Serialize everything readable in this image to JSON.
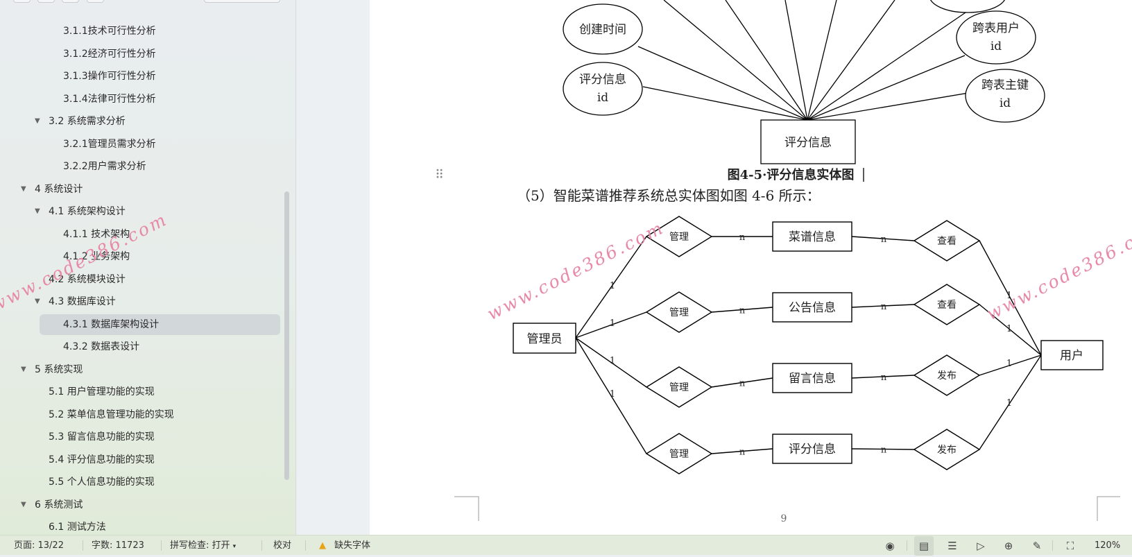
{
  "sidebar": {
    "toc": [
      {
        "label": "3.1.1技术可行性分析",
        "level": 3
      },
      {
        "label": "3.1.2经济可行性分析",
        "level": 3
      },
      {
        "label": "3.1.3操作可行性分析",
        "level": 3
      },
      {
        "label": "3.1.4法律可行性分析",
        "level": 3
      },
      {
        "label": "3.2 系统需求分析",
        "level": 2,
        "expanded": true
      },
      {
        "label": "3.2.1管理员需求分析",
        "level": 3
      },
      {
        "label": "3.2.2用户需求分析",
        "level": 3
      },
      {
        "label": "4 系统设计",
        "level": 1,
        "expanded": true
      },
      {
        "label": "4.1 系统架构设计",
        "level": 2,
        "expanded": true
      },
      {
        "label": "4.1.1 技术架构",
        "level": 3
      },
      {
        "label": "4.1.2 业务架构",
        "level": 3
      },
      {
        "label": "4.2 系统模块设计",
        "level": 2
      },
      {
        "label": "4.3 数据库设计",
        "level": 2,
        "expanded": true
      },
      {
        "label": "4.3.1 数据库架构设计",
        "level": 3,
        "selected": true
      },
      {
        "label": "4.3.2 数据表设计",
        "level": 3
      },
      {
        "label": "5 系统实现",
        "level": 1,
        "expanded": true
      },
      {
        "label": "5.1 用户管理功能的实现",
        "level": 2
      },
      {
        "label": "5.2 菜单信息管理功能的实现",
        "level": 2
      },
      {
        "label": "5.3 留言信息功能的实现",
        "level": 2
      },
      {
        "label": "5.4 评分信息功能的实现",
        "level": 2
      },
      {
        "label": "5.5 个人信息功能的实现",
        "level": 2
      },
      {
        "label": "6 系统测试",
        "level": 1,
        "expanded": true
      },
      {
        "label": "6.1 测试方法",
        "level": 2
      }
    ]
  },
  "document": {
    "fig45": {
      "attributes": [
        "创建时间",
        "评分信息",
        "跨表用户",
        "跨表主键"
      ],
      "id_suffix": "id",
      "entity": "评分信息",
      "caption": "图4-5·评分信息实体图"
    },
    "paragraph": "（5）智能菜谱推荐系统总实体图如图 4-6 所示：",
    "fig46": {
      "admin": "管理员",
      "user": "用户",
      "manage": "管理",
      "entities": [
        "菜谱信息",
        "公告信息",
        "留言信息",
        "评分信息"
      ],
      "user_relations": [
        "查看",
        "查看",
        "发布",
        "发布"
      ],
      "one": "1",
      "many": "n"
    },
    "page_number": "9",
    "watermark": "www.code386.com"
  },
  "status": {
    "page": "页面: 13/22",
    "words": "字数: 11723",
    "spell": "拼写检查: 打开",
    "proof": "校对",
    "missing_font": "缺失字体",
    "zoom": "120%"
  }
}
